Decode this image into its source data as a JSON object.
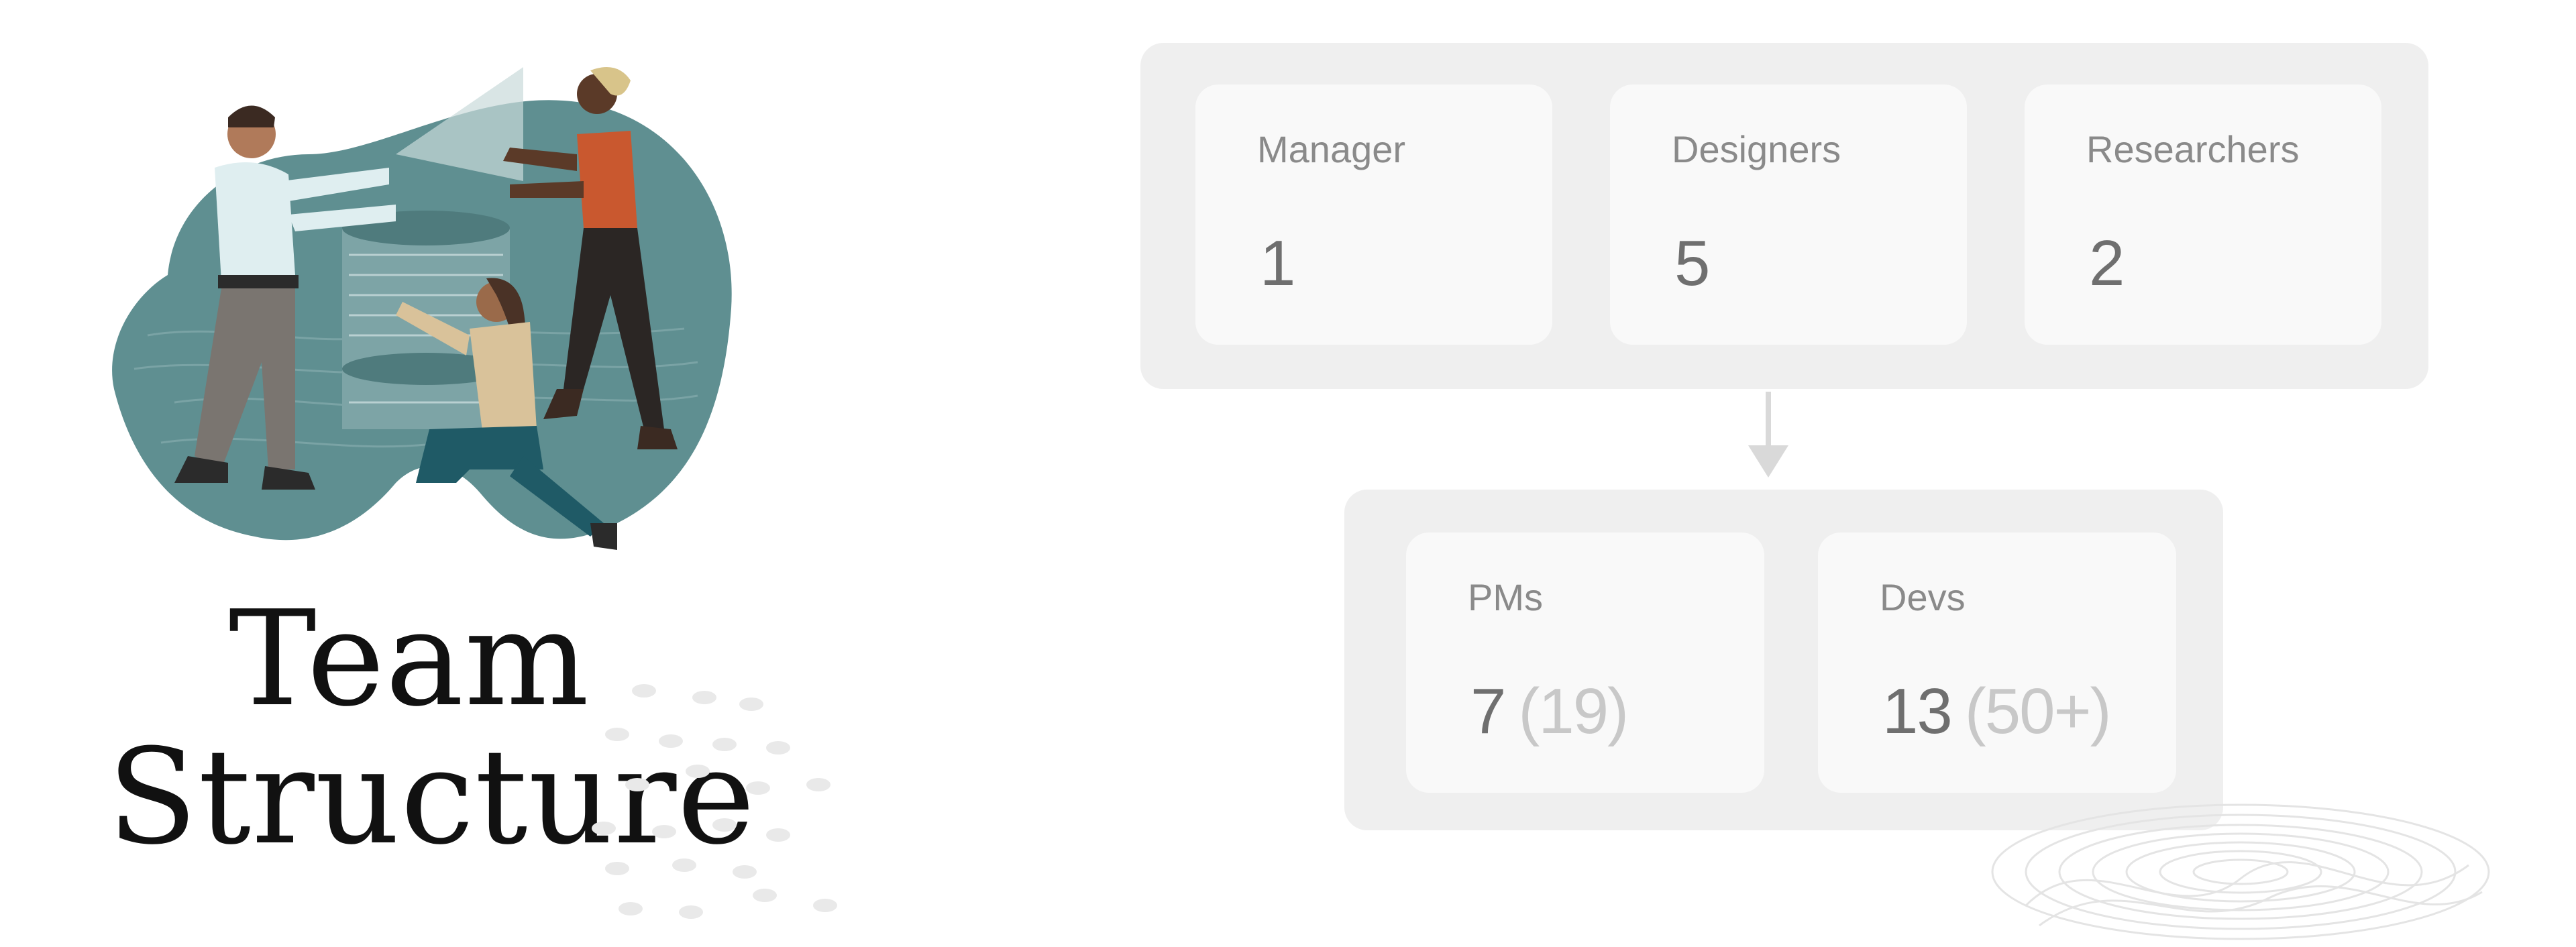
{
  "title": {
    "line1": "Team",
    "line2": "Structure"
  },
  "top_group": {
    "cards": [
      {
        "label": "Manager",
        "value": "1"
      },
      {
        "label": "Designers",
        "value": "5"
      },
      {
        "label": "Researchers",
        "value": "2"
      }
    ]
  },
  "bottom_group": {
    "cards": [
      {
        "label": "PMs",
        "value": "7",
        "extra": "(19)"
      },
      {
        "label": "Devs",
        "value": "13",
        "extra": "(50+)"
      }
    ]
  },
  "colors": {
    "panel": "#efefef",
    "card": "#f9f9f9",
    "label": "#8a8a8a",
    "value": "#6f6f6f",
    "extra": "#c8c8c8",
    "illustration_blob": "#5f8f91"
  }
}
